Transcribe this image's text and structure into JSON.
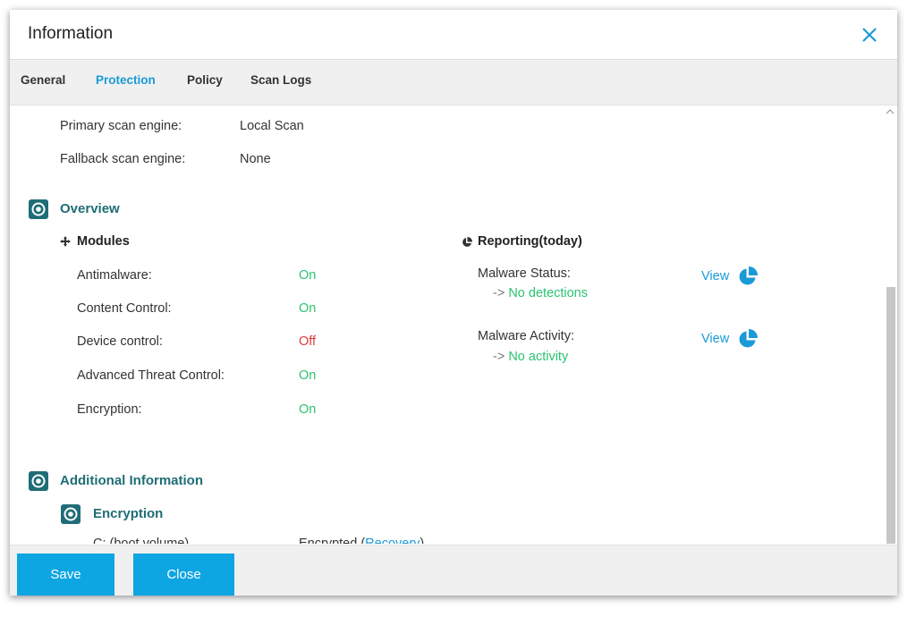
{
  "dialog": {
    "title": "Information"
  },
  "tabs": [
    {
      "label": "General"
    },
    {
      "label": "Protection"
    },
    {
      "label": "Policy"
    },
    {
      "label": "Scan Logs"
    }
  ],
  "scan": {
    "primary_label": "Primary scan engine:",
    "primary_value": "Local Scan",
    "fallback_label": "Fallback scan engine:",
    "fallback_value": "None"
  },
  "overview": {
    "title": "Overview",
    "modules_title": "Modules",
    "modules": [
      {
        "label": "Antimalware:",
        "status": "On"
      },
      {
        "label": "Content Control:",
        "status": "On"
      },
      {
        "label": "Device control:",
        "status": "Off"
      },
      {
        "label": "Advanced Threat Control:",
        "status": "On"
      },
      {
        "label": "Encryption:",
        "status": "On"
      }
    ],
    "reporting_title": "Reporting(today)",
    "reports": [
      {
        "label": "Malware Status:",
        "arrow": "->",
        "detail": "No detections",
        "link": "View"
      },
      {
        "label": "Malware Activity:",
        "arrow": "->",
        "detail": "No activity",
        "link": "View"
      }
    ]
  },
  "additional": {
    "title": "Additional Information",
    "encryption_title": "Encryption",
    "volume_label": "C: (boot volume)",
    "volume_status": "Encrypted",
    "open_paren": "(",
    "recovery_link": "Recovery",
    "close_paren": ")"
  },
  "footer": {
    "save_label": "Save",
    "close_label": "Close"
  },
  "colors": {
    "accent": "#1a9ad6",
    "section": "#1f6d76",
    "on": "#2bc371",
    "off": "#e03a3a",
    "button": "#0ea5e3"
  },
  "icons": {
    "close": "close-icon",
    "section": "target-icon",
    "modules": "move-icon",
    "reporting": "pie-chart-icon",
    "view": "pie-chart-icon"
  }
}
